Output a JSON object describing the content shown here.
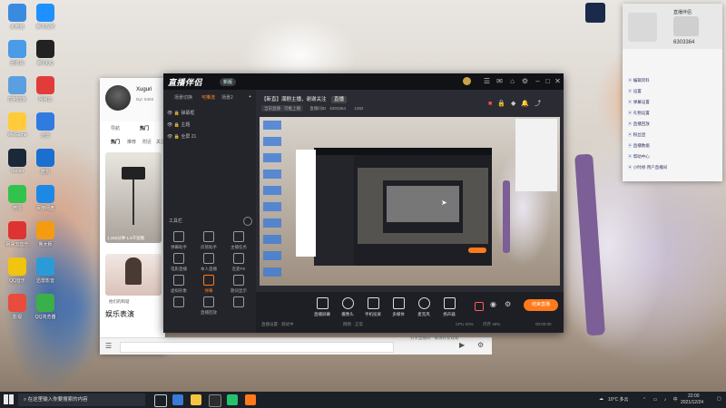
{
  "desktop_icons": [
    {
      "label": "此电脑"
    },
    {
      "label": "腾讯视频"
    },
    {
      "label": "回收站"
    },
    {
      "label": "腾讯QQ"
    },
    {
      "label": "控制面板"
    },
    {
      "label": "网易云"
    },
    {
      "label": "WeGame"
    },
    {
      "label": "迅雷"
    },
    {
      "label": "Steam"
    },
    {
      "label": "酷狗"
    },
    {
      "label": "微信"
    },
    {
      "label": "百度网盘"
    },
    {
      "label": "网易云音乐"
    },
    {
      "label": "鲁大师"
    },
    {
      "label": "QQ音乐"
    },
    {
      "label": "迅雷影音"
    },
    {
      "label": "影视"
    },
    {
      "label": "QQ浏览器"
    }
  ],
  "chat_panel": {
    "username": "Xuguri",
    "user_id": "Dyi: 6303",
    "tabs": [
      "导航",
      "热门"
    ],
    "subtabs": [
      "热门",
      "推荐",
      "附近",
      "关注"
    ],
    "card1_caption": "1,150分钟 1.5千观看",
    "card2_caption": "他们的和谐",
    "section_title": "娱乐表演"
  },
  "app": {
    "logo": "直播伴侣",
    "version": "新版",
    "scene_tabs": [
      "场景切换",
      "可推流",
      "场景2"
    ],
    "sources": [
      "弹幕框",
      "主题",
      "全屏 21"
    ],
    "tools_title": "工具栏",
    "tools": [
      "弹幕助手",
      "房管助手",
      "主播任务",
      "电影直播",
      "本人直播",
      "连麦PK",
      "虚拟形象",
      "弹幕",
      "歌词显示",
      "",
      "直播回放",
      ""
    ],
    "room_title": "【新直】潮剧主播，谢谢关注",
    "room_tag": "直播",
    "room_info": [
      "当前直播 · 可推上播",
      "直播间ID",
      "6303364",
      "1292"
    ],
    "bottom_buttons": [
      "直播屏幕",
      "摄像头",
      "手机投屏",
      "多媒体",
      "麦克风",
      "扬声器"
    ],
    "start_label": "结束直播",
    "status_items": [
      "直播设置 · 调试中",
      "网络 · 正常",
      "CPU 20%",
      "内存 49%"
    ],
    "timer": "00:00:00",
    "bottom_notice": "分享直播间 · 邀请好友观看"
  },
  "side_panel": {
    "title": "直播伴侣",
    "number": "6303364",
    "rows": [
      "编辑资料",
      "设置",
      "弹幕设置",
      "礼物设置",
      "直播回放",
      "粉丝团",
      "直播数据",
      "帮助中心",
      "小时榜·用户直播间"
    ]
  },
  "taskbar": {
    "search_placeholder": "在这里输入你要搜索的内容",
    "weather": "10°C 多云",
    "time": "22:00",
    "date": "2021/12/24"
  }
}
